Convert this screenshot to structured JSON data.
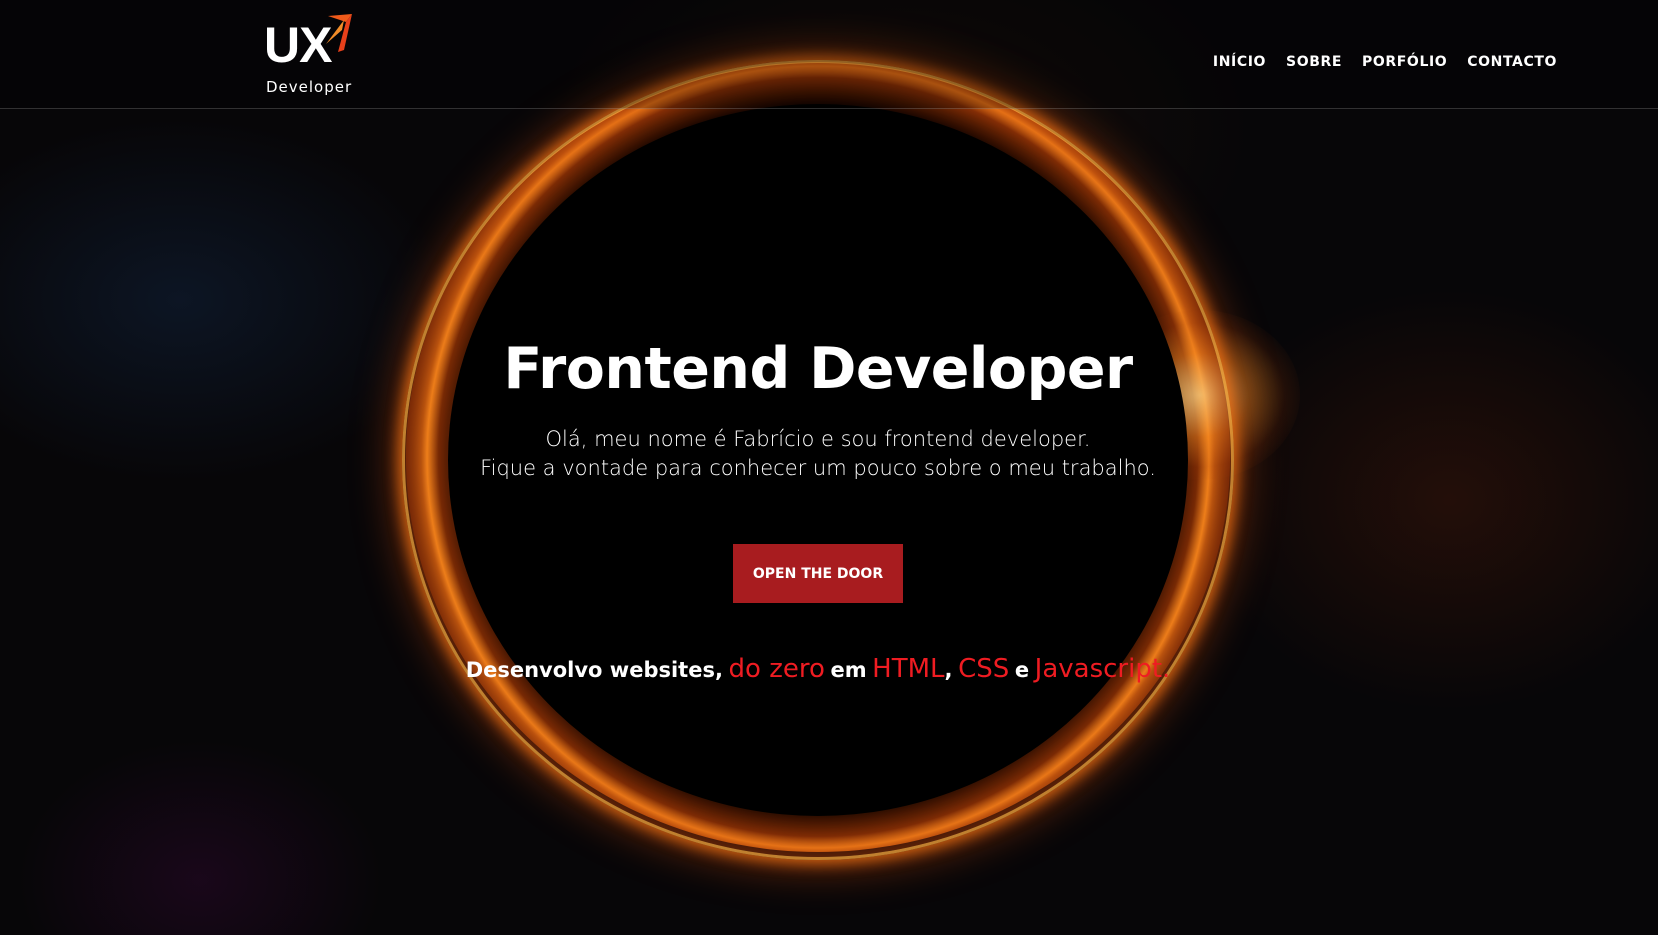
{
  "header": {
    "logo": {
      "main": "UX",
      "sub": "Developer"
    },
    "nav": [
      {
        "label": "INÍCIO"
      },
      {
        "label": "SOBRE"
      },
      {
        "label": "PORFÓLIO"
      },
      {
        "label": "CONTACTO"
      }
    ]
  },
  "hero": {
    "title": "Frontend Developer",
    "line1": "Olá, meu nome é Fabrício e sou frontend developer.",
    "line2": "Fique a vontade para conhecer um pouco sobre o meu trabalho.",
    "cta_label": "OPEN THE DOOR",
    "tagline": {
      "part1": "Desenvolvo websites,",
      "part2": "do zero",
      "part3": "em",
      "part4": "HTML",
      "part5": ",",
      "part6": "CSS",
      "part7": "e",
      "part8": "Javascript."
    }
  },
  "colors": {
    "accent_red": "#ef1c22",
    "button_red": "#a81c1f",
    "eclipse_orange": "#ff8c1e",
    "background": "#070608"
  },
  "icons": {
    "logo_mark": "orange-arrow-mark"
  }
}
